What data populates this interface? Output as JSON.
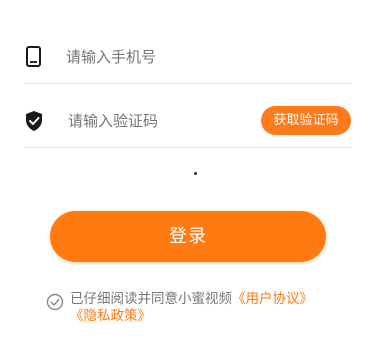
{
  "form": {
    "phone_placeholder": "请输入手机号",
    "code_placeholder": "请输入验证码",
    "get_code_label": "获取验证码",
    "login_label": "登录"
  },
  "agreement": {
    "prefix": "已仔细阅读并同意小蜜视频",
    "user_agreement": "《用户协议》",
    "privacy_policy": "《隐私政策》"
  },
  "icons": {
    "phone": "phone-icon",
    "shield": "shield-check-icon",
    "check": "check-circle-icon"
  },
  "colors": {
    "accent": "#ff7a10",
    "placeholder": "#b5b5b5",
    "divider": "#e6e6e6"
  }
}
